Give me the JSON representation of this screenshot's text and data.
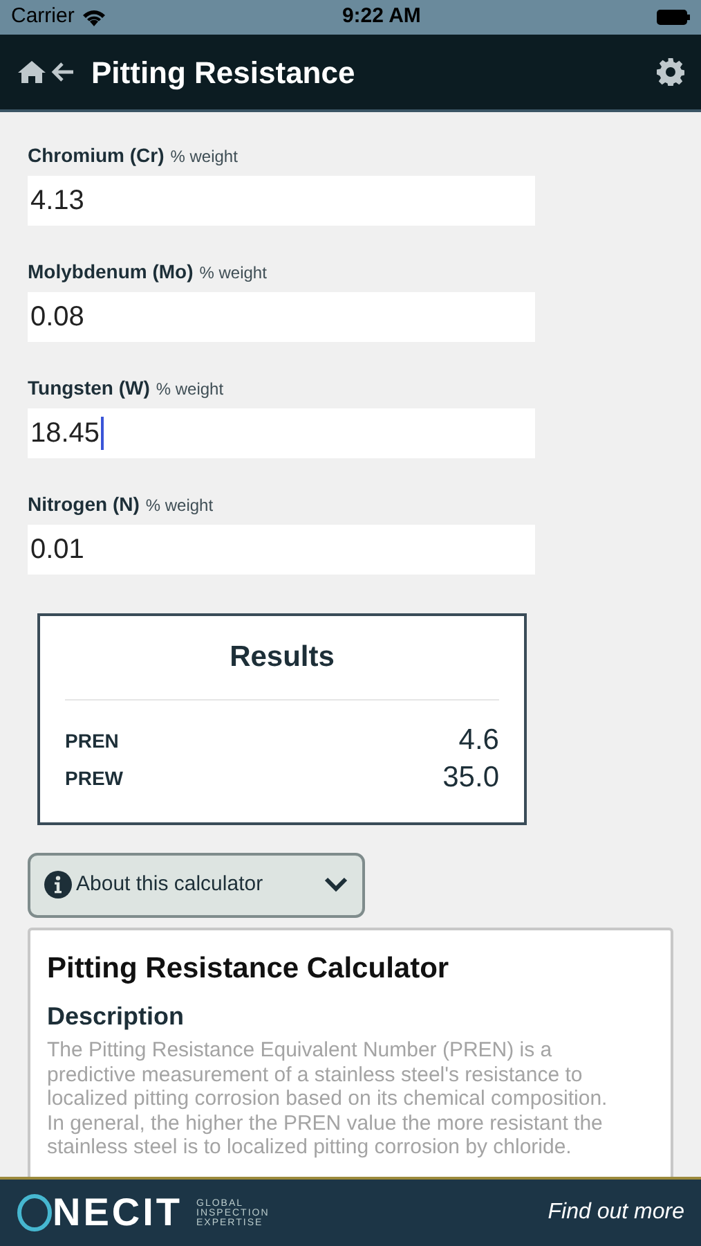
{
  "status_bar": {
    "carrier": "Carrier",
    "time": "9:22 AM"
  },
  "header": {
    "title": "Pitting Resistance"
  },
  "fields": [
    {
      "label": "Chromium (Cr)",
      "unit": "% weight",
      "value": "4.13",
      "focused": false
    },
    {
      "label": "Molybdenum (Mo)",
      "unit": "% weight",
      "value": "0.08",
      "focused": false
    },
    {
      "label": "Tungsten (W)",
      "unit": "% weight",
      "value": "18.45",
      "focused": true
    },
    {
      "label": "Nitrogen (N)",
      "unit": "% weight",
      "value": "0.01",
      "focused": false
    }
  ],
  "results": {
    "title": "Results",
    "rows": [
      {
        "label": "PREN",
        "value": "4.6"
      },
      {
        "label": "PREW",
        "value": "35.0"
      }
    ]
  },
  "about": {
    "toggle": "About this calculator",
    "expanded": true,
    "title": "Pitting Resistance Calculator",
    "heading": "Description",
    "paragraphs": [
      "The Pitting Resistance Equivalent Number (PREN) is a predictive measurement of a stainless steel's resistance to localized pitting corrosion based on its chemical composition. In general, the higher the PREN value the more resistant the stainless steel is to localized pitting corrosion by chloride."
    ]
  },
  "banner": {
    "logo": "NECIT",
    "tagline": [
      "GLOBAL",
      "INSPECTION",
      "EXPERTISE"
    ],
    "link": "Find out more"
  }
}
